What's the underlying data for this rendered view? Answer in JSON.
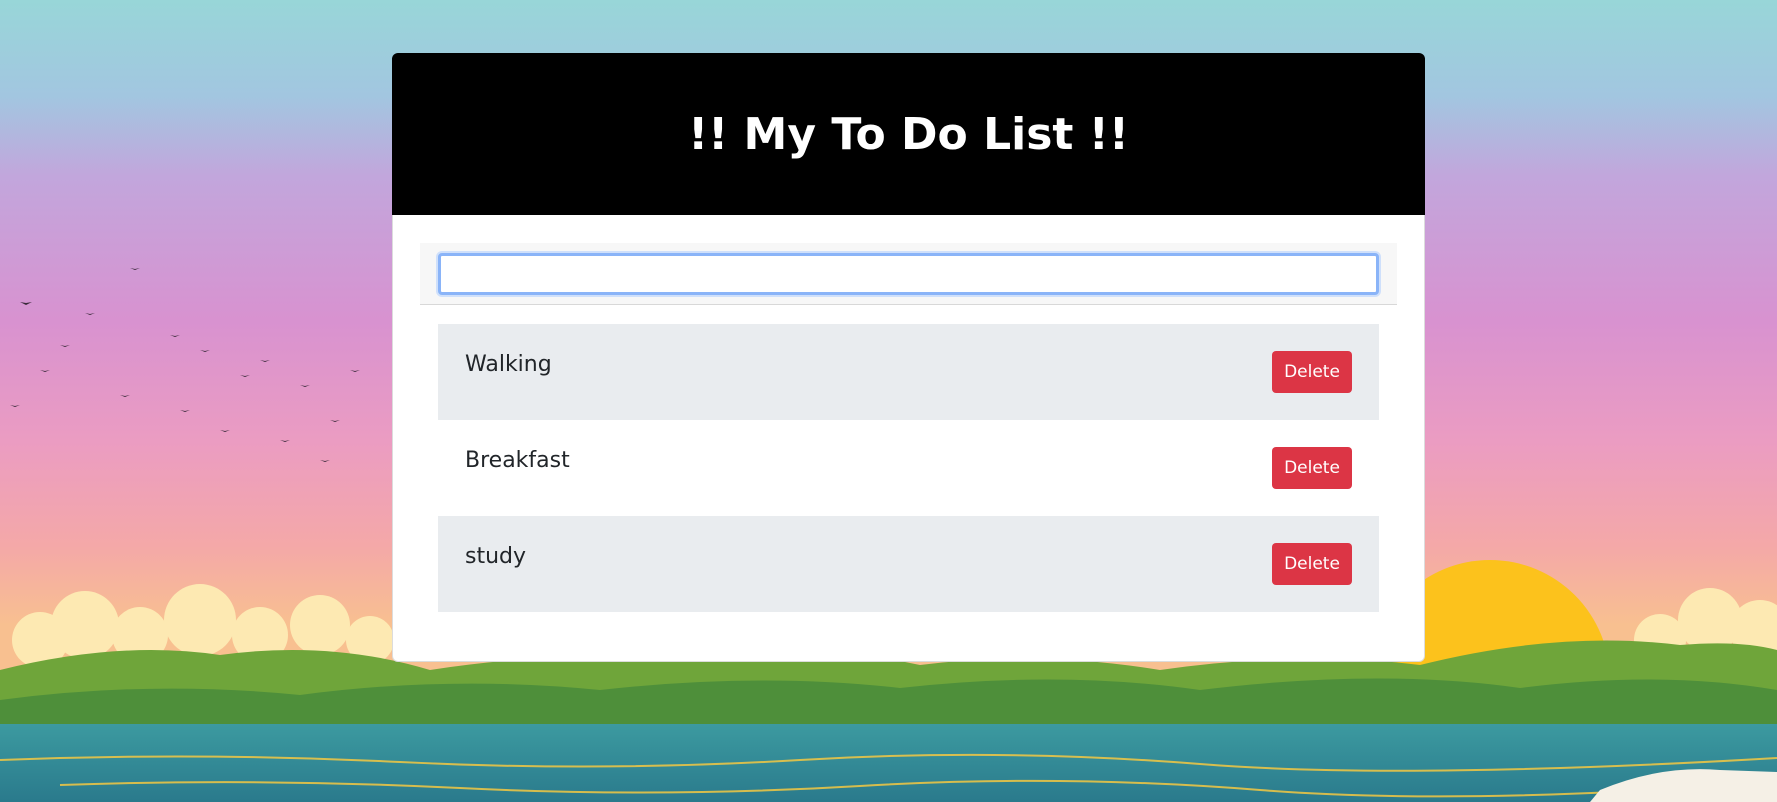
{
  "header": {
    "title": "!! My To Do List !!"
  },
  "input": {
    "value": "",
    "placeholder": ""
  },
  "todos": [
    {
      "label": "Walking",
      "delete_label": "Delete"
    },
    {
      "label": "Breakfast",
      "delete_label": "Delete"
    },
    {
      "label": "study",
      "delete_label": "Delete"
    }
  ],
  "colors": {
    "header_bg": "#000000",
    "delete_button": "#dc3545",
    "row_alt": "#e9ecef",
    "input_focus": "#8ab4f8"
  }
}
